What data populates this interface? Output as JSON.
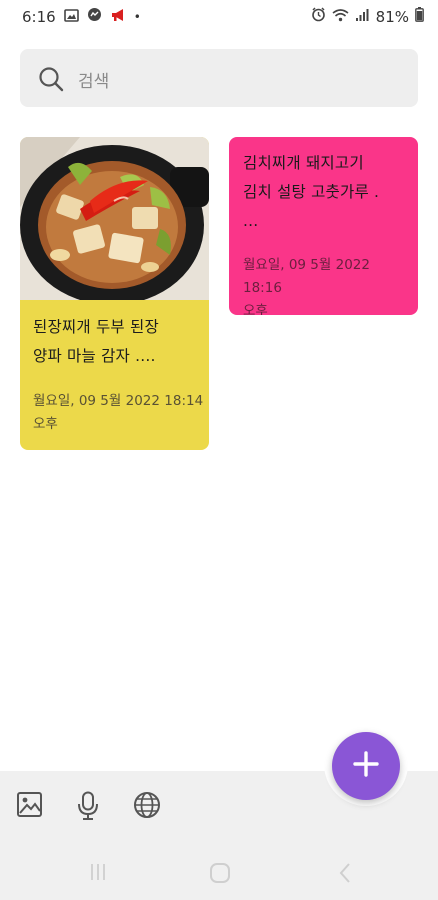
{
  "status_bar": {
    "time": "6:16",
    "dot": "•",
    "battery_text": "81%",
    "icons": [
      "image-icon",
      "messenger-icon",
      "megaphone-icon",
      "alarm-icon",
      "wifi-icon",
      "signal-icon",
      "battery-icon"
    ]
  },
  "search": {
    "placeholder": "검색",
    "icon": "search-icon"
  },
  "notes": [
    {
      "text": "된장찌개 두부 된장\n양파 마늘 감자  ....",
      "date": "월요일, 09 5월 2022 18:14\n오후",
      "color": "#ecd94a",
      "has_image": true
    },
    {
      "text": "김치찌개 돼지고기\n김치 설탕 고춧가루 .\n...",
      "date": "월요일, 09 5월 2022 18:16\n오후",
      "color": "#fa3589",
      "has_image": false
    }
  ],
  "bottom_toolbar": {
    "icons": [
      "add-image-icon",
      "microphone-icon",
      "globe-icon"
    ]
  },
  "fab": {
    "icon": "plus-icon",
    "color": "#8a56d6"
  },
  "nav_bar": {
    "icons": [
      "recent-apps-icon",
      "home-icon",
      "back-icon"
    ]
  }
}
